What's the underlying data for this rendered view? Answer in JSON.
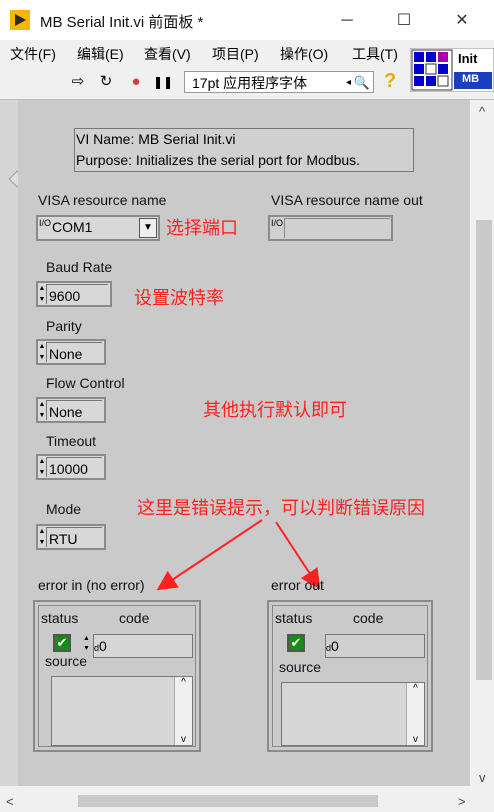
{
  "window": {
    "title": "MB Serial Init.vi 前面板 *",
    "minimize_glyph": "─",
    "maximize_glyph": "☐",
    "close_glyph": "✕"
  },
  "menu": [
    "文件(F)",
    "编辑(E)",
    "查看(V)",
    "项目(P)",
    "操作(O)",
    "工具(T)"
  ],
  "toolbar": {
    "run_icon": "⇨",
    "run_continuous_icon": "↻",
    "abort_icon": "●",
    "pause_icon": "❚❚",
    "font_select": "17pt 应用程序字体",
    "font_dropdown_glyph": "◂",
    "search_icon": "🔍",
    "help_icon": "?"
  },
  "vi_icon": {
    "line1": "Init",
    "line2": "MB"
  },
  "panel": {
    "description_line1": "VI Name: MB Serial Init.vi",
    "description_line2": "Purpose: Initializes the serial port for Modbus.",
    "visa_in": {
      "label": "VISA resource name",
      "value": "COM1",
      "prefix": "I/O"
    },
    "visa_out": {
      "label": "VISA resource name out",
      "value": "",
      "prefix": "I/O"
    },
    "baud": {
      "label": "Baud Rate",
      "value": "9600"
    },
    "parity": {
      "label": "Parity",
      "value": "None"
    },
    "flow": {
      "label": "Flow Control",
      "value": "None"
    },
    "timeout": {
      "label": "Timeout",
      "value": "10000"
    },
    "mode": {
      "label": "Mode",
      "value": "RTU"
    },
    "error_in": {
      "label": "error in (no error)",
      "status_label": "status",
      "code_label": "code",
      "code_value": "0",
      "source_label": "source",
      "code_prefix": "d"
    },
    "error_out": {
      "label": "error out",
      "status_label": "status",
      "code_label": "code",
      "code_value": "0",
      "source_label": "source",
      "code_prefix": "d"
    }
  },
  "annotations": {
    "select_port": "选择端口",
    "set_baud": "设置波特率",
    "defaults": "其他执行默认即可",
    "error_hint": "这里是错误提示，可以判断错误原因"
  },
  "colors": {
    "annotation": "#ff2020",
    "panel": "#cacaca",
    "vi_icon_bg": "#0000cc"
  }
}
